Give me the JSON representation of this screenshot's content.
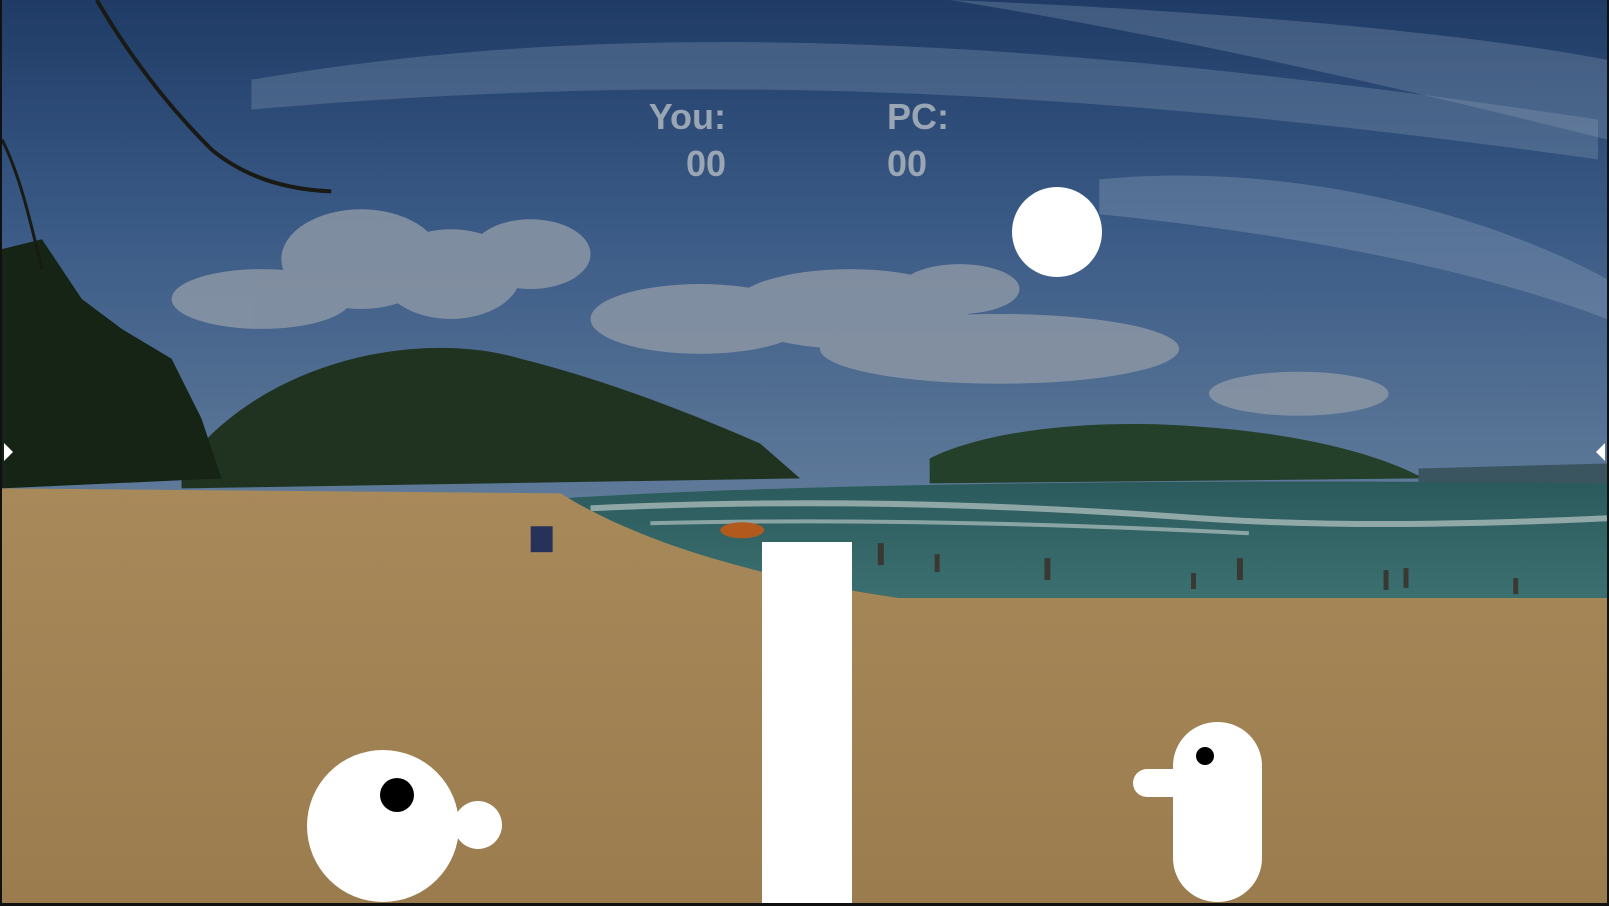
{
  "scoreboard": {
    "you_label": "You:",
    "you_score": "00",
    "pc_label": "PC:",
    "pc_score": "00"
  },
  "colors": {
    "score_text": "#9aa6b4",
    "game_objects": "#ffffff",
    "eyes": "#000000"
  },
  "icons": {
    "left_edge": "triangle-right-icon",
    "right_edge": "triangle-left-icon"
  }
}
